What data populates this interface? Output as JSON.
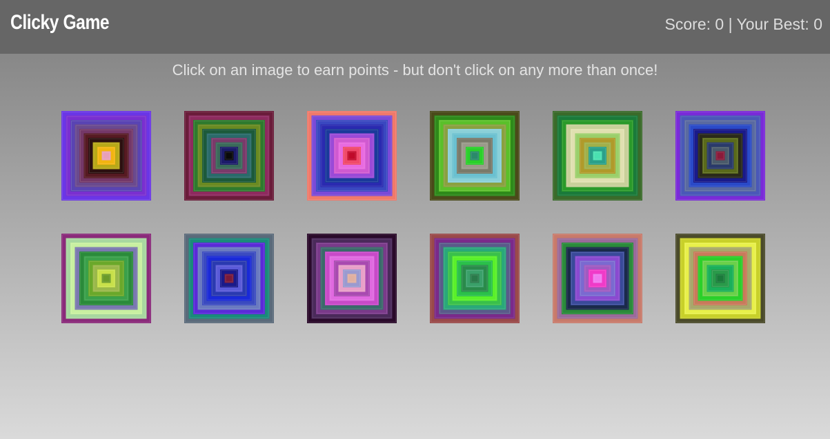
{
  "navbar": {
    "brand": "Clicky Game",
    "score_text": "Score: 0 | Your Best: 0"
  },
  "instructions": "Click on an image to earn points - but don't click on any more than once!",
  "score": 0,
  "best": 0,
  "tiles": [
    {
      "name": "tile-1",
      "colors": [
        "#6a36e6",
        "#7a2fd0",
        "#5944b3",
        "#6a4a8e",
        "#743868",
        "#561a22",
        "#2c1010",
        "#b8a818",
        "#f2b410",
        "#e8a0b8"
      ]
    },
    {
      "name": "tile-2",
      "colors": [
        "#6a1c3a",
        "#8e2a5e",
        "#2e7a2e",
        "#6a8a22",
        "#1c5a3a",
        "#2a6a6a",
        "#7a3a6a",
        "#3a6a5a",
        "#1c1c6a",
        "#0a0a0a"
      ]
    },
    {
      "name": "tile-3",
      "colors": [
        "#f07a6a",
        "#7a4ad8",
        "#3a48c0",
        "#2a2ab0",
        "#1a3a9a",
        "#9a4ad8",
        "#d05ad0",
        "#e86ae0",
        "#f04a6a",
        "#c00a2a"
      ]
    },
    {
      "name": "tile-4",
      "colors": [
        "#4a4a1a",
        "#2e8a1a",
        "#5ac02a",
        "#8aa040",
        "#8ad0d8",
        "#6ac0d0",
        "#7a7a6a",
        "#9a9a8a",
        "#2ad02a",
        "#2a8a6a"
      ]
    },
    {
      "name": "tile-5",
      "colors": [
        "#3a6a2a",
        "#1a7a3a",
        "#2a9a2a",
        "#c8d09a",
        "#e0e0b0",
        "#9acf6a",
        "#b09a2a",
        "#a0b04a",
        "#2aa08a",
        "#4ae0b0"
      ]
    },
    {
      "name": "tile-6",
      "colors": [
        "#7a2ad8",
        "#4a58b8",
        "#5a6aa0",
        "#2a4ac8",
        "#1a1a8a",
        "#2a2a1a",
        "#5a6a1a",
        "#2a3a6a",
        "#4a5a6a",
        "#8a1a3a"
      ]
    },
    {
      "name": "tile-7",
      "colors": [
        "#8a2a7a",
        "#a8d8a0",
        "#c8f0a0",
        "#7a78b0",
        "#2a8a3a",
        "#3aa04a",
        "#6aa82a",
        "#9ab84a",
        "#c8e04a",
        "#6a9a2a"
      ]
    },
    {
      "name": "tile-8",
      "colors": [
        "#5a6a7a",
        "#1a8a7a",
        "#5a2ad8",
        "#6a7ac0",
        "#3a4ac0",
        "#1a2ad8",
        "#2a3ab0",
        "#5a5ad8",
        "#1a1a8a",
        "#7a1a3a"
      ]
    },
    {
      "name": "tile-9",
      "colors": [
        "#2a0a2a",
        "#4a2a5a",
        "#7a3a8a",
        "#3a6a6a",
        "#c84ac8",
        "#e06ae0",
        "#a84ab0",
        "#e8a0c8",
        "#9a9ad0",
        "#e0b0a0"
      ]
    },
    {
      "name": "tile-10",
      "colors": [
        "#9a4a4a",
        "#7a2a8a",
        "#5a5a8a",
        "#2aa87a",
        "#3ac04a",
        "#5af02a",
        "#2ac04a",
        "#2a8a4a",
        "#3aa06a",
        "#2a7a4a"
      ]
    },
    {
      "name": "tile-11",
      "colors": [
        "#c87a6a",
        "#9a6a9a",
        "#2a8a3a",
        "#1a2a4a",
        "#3a4a9a",
        "#8a4ad0",
        "#7a6ad0",
        "#a05ac0",
        "#f03ac8",
        "#f07af0"
      ]
    },
    {
      "name": "tile-12",
      "colors": [
        "#4a4a2a",
        "#c8d02a",
        "#e8f04a",
        "#a8a86a",
        "#c87a5a",
        "#2ad02a",
        "#6ad04a",
        "#1ab05a",
        "#2a9a4a",
        "#1a7a3a"
      ]
    }
  ]
}
